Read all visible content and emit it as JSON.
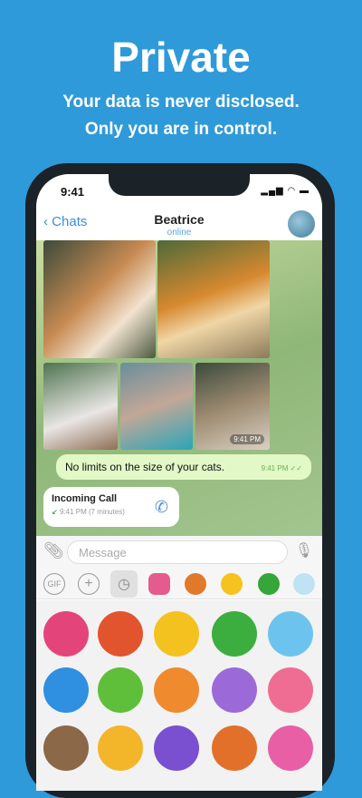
{
  "hero": {
    "title": "Private",
    "subtitle_line1": "Your data is never disclosed.",
    "subtitle_line2": "Only you are in control."
  },
  "status_bar": {
    "time": "9:41",
    "icons": "signal-wifi-battery"
  },
  "header": {
    "back_label": "Chats",
    "title": "Beatrice",
    "status": "online"
  },
  "messages": [
    {
      "type": "photo-album",
      "timestamp": "9:41 PM"
    },
    {
      "type": "text",
      "text": "No limits on the size of your cats.",
      "time": "9:41 PM"
    },
    {
      "type": "call",
      "title": "Incoming Call",
      "detail": "9:41 PM (7 minutes)"
    }
  ],
  "input": {
    "placeholder": "Message"
  },
  "sticker_tabs": [
    "gif",
    "add",
    "recent",
    "starfish",
    "monster",
    "duck",
    "virus",
    "ghost"
  ],
  "colors": {
    "brand": "#2f9ad9",
    "link": "#3d8ee0",
    "outgoing_bubble": "#e2f8c6"
  }
}
